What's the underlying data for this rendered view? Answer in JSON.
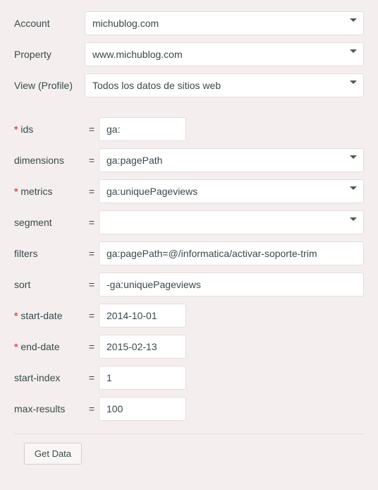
{
  "account": {
    "label": "Account",
    "value": "michublog.com"
  },
  "property": {
    "label": "Property",
    "value": "www.michublog.com"
  },
  "view": {
    "label": "View (Profile)",
    "value": "Todos los datos de sitios web"
  },
  "fields": {
    "ids": {
      "label": "ids",
      "required": true,
      "value": "ga:"
    },
    "dimensions": {
      "label": "dimensions",
      "required": false,
      "value": "ga:pagePath"
    },
    "metrics": {
      "label": "metrics",
      "required": true,
      "value": "ga:uniquePageviews"
    },
    "segment": {
      "label": "segment",
      "required": false,
      "value": ""
    },
    "filters": {
      "label": "filters",
      "required": false,
      "value": "ga:pagePath=@/informatica/activar-soporte-trim"
    },
    "sort": {
      "label": "sort",
      "required": false,
      "value": "-ga:uniquePageviews"
    },
    "start_date": {
      "label": "start-date",
      "required": true,
      "value": "2014-10-01"
    },
    "end_date": {
      "label": "end-date",
      "required": true,
      "value": "2015-02-13"
    },
    "start_index": {
      "label": "start-index",
      "required": false,
      "value": "1"
    },
    "max_results": {
      "label": "max-results",
      "required": false,
      "value": "100"
    }
  },
  "eq": "=",
  "actions": {
    "get_data": "Get Data"
  }
}
